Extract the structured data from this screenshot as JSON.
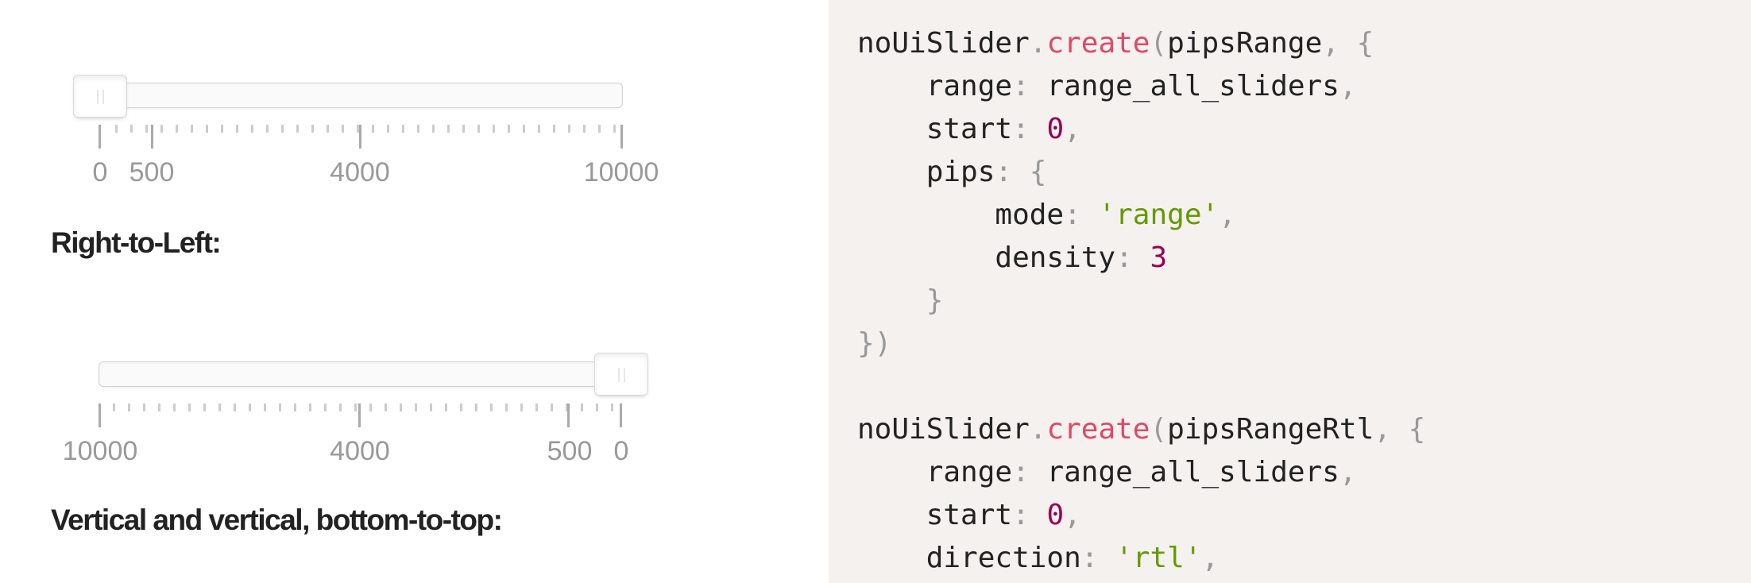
{
  "sliders": [
    {
      "id": "pips-range",
      "direction": "ltr",
      "value": 0,
      "labels": [
        "0",
        "500",
        "4000",
        "10000"
      ]
    },
    {
      "id": "pips-range-rtl",
      "direction": "rtl",
      "value": 0,
      "labels": [
        "10000",
        "4000",
        "500",
        "0"
      ]
    }
  ],
  "headings": {
    "rtl": "Right-to-Left:",
    "vertical": "Vertical and vertical, bottom-to-top:"
  },
  "code": {
    "lines": [
      [
        [
          "plain",
          "noUiSlider"
        ],
        [
          "pun",
          "."
        ],
        [
          "fn",
          "create"
        ],
        [
          "pun",
          "("
        ],
        [
          "plain",
          "pipsRange"
        ],
        [
          "pun",
          ", {"
        ]
      ],
      [
        [
          "plain",
          "    range"
        ],
        [
          "pun",
          ": "
        ],
        [
          "plain",
          "range_all_sliders"
        ],
        [
          "pun",
          ","
        ]
      ],
      [
        [
          "plain",
          "    start"
        ],
        [
          "pun",
          ": "
        ],
        [
          "num",
          "0"
        ],
        [
          "pun",
          ","
        ]
      ],
      [
        [
          "plain",
          "    pips"
        ],
        [
          "pun",
          ": {"
        ]
      ],
      [
        [
          "plain",
          "        mode"
        ],
        [
          "pun",
          ": "
        ],
        [
          "str",
          "'range'"
        ],
        [
          "pun",
          ","
        ]
      ],
      [
        [
          "plain",
          "        density"
        ],
        [
          "pun",
          ": "
        ],
        [
          "num",
          "3"
        ]
      ],
      [
        [
          "pun",
          "    }"
        ]
      ],
      [
        [
          "pun",
          "})"
        ]
      ],
      [],
      [
        [
          "plain",
          "noUiSlider"
        ],
        [
          "pun",
          "."
        ],
        [
          "fn",
          "create"
        ],
        [
          "pun",
          "("
        ],
        [
          "plain",
          "pipsRangeRtl"
        ],
        [
          "pun",
          ", {"
        ]
      ],
      [
        [
          "plain",
          "    range"
        ],
        [
          "pun",
          ": "
        ],
        [
          "plain",
          "range_all_sliders"
        ],
        [
          "pun",
          ","
        ]
      ],
      [
        [
          "plain",
          "    start"
        ],
        [
          "pun",
          ": "
        ],
        [
          "num",
          "0"
        ],
        [
          "pun",
          ","
        ]
      ],
      [
        [
          "plain",
          "    direction"
        ],
        [
          "pun",
          ": "
        ],
        [
          "str",
          "'rtl'"
        ],
        [
          "pun",
          ","
        ]
      ]
    ]
  }
}
